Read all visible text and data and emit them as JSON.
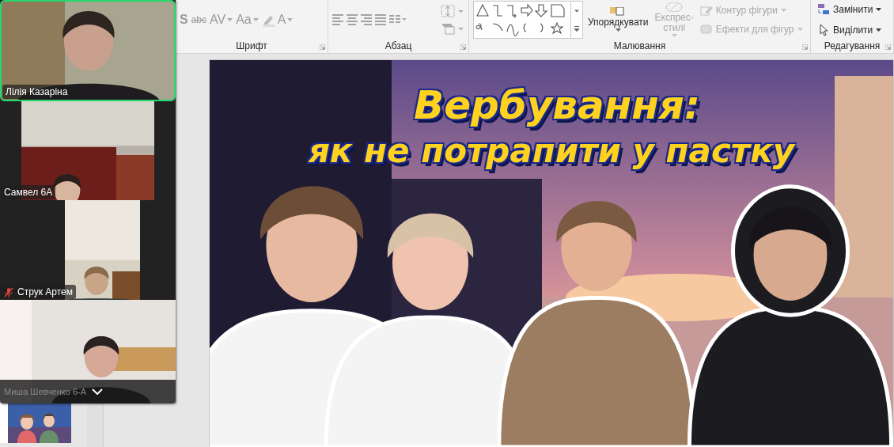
{
  "ribbon": {
    "font_group": {
      "label": "Шрифт",
      "tools": [
        "S",
        "abc",
        "AV",
        "Aa",
        "A"
      ]
    },
    "paragraph_group": {
      "label": "Абзац"
    },
    "drawing_group": {
      "label": "Малювання",
      "commands": [
        {
          "kind": "large",
          "label": "Упорядкувати",
          "disabled": false
        },
        {
          "kind": "large",
          "label": "Експрес-стилі",
          "disabled": true
        },
        {
          "kind": "small",
          "label": "Контур фігури",
          "disabled": true
        },
        {
          "kind": "small",
          "label": "Ефекти для фігур",
          "disabled": true
        }
      ]
    },
    "editing_group": {
      "label": "Редагування",
      "commands": [
        {
          "kind": "replace",
          "label": "Замінити",
          "disabled": false
        },
        {
          "kind": "select",
          "label": "Виділити",
          "disabled": false
        }
      ]
    }
  },
  "slide": {
    "title_lines": [
      "Вербування:",
      "як не потрапити у пастку"
    ]
  },
  "video_panel": {
    "participants": [
      {
        "name": "Лілія Казаріна",
        "active_speaker": true,
        "muted": false
      },
      {
        "name": "Самвел 6А",
        "active_speaker": false,
        "muted": false
      },
      {
        "name": "Струк Артем",
        "active_speaker": false,
        "muted": true
      },
      {
        "name": "Миша Шевченко 6-А",
        "active_speaker": false,
        "muted": false
      }
    ]
  }
}
